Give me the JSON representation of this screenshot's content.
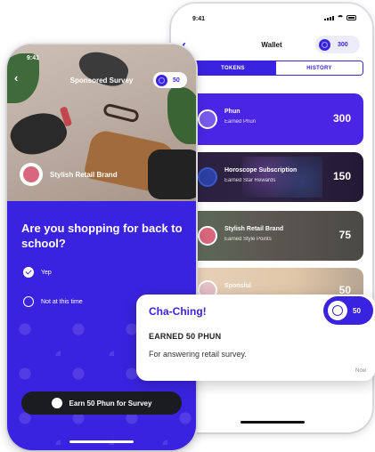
{
  "wallet_screen": {
    "status_time": "9:41",
    "back_icon": "chevron-left-icon",
    "title": "Wallet",
    "balance": "300",
    "tabs": [
      {
        "label": "TOKENS",
        "active": true
      },
      {
        "label": "HISTORY",
        "active": false
      }
    ],
    "cards": [
      {
        "title": "Phun",
        "subtitle": "Earned Phun",
        "value": "300"
      },
      {
        "title": "Horoscope Subscription",
        "subtitle": "Earned Star Rewards",
        "value": "150"
      },
      {
        "title": "Stylish Retail Brand",
        "subtitle": "Earned Style Points",
        "value": "75"
      },
      {
        "title": "Sponsful",
        "subtitle": "",
        "value": "50"
      }
    ]
  },
  "survey_screen": {
    "status_time": "9:41",
    "back_icon": "chevron-left-icon",
    "title": "Sponsored Survey",
    "reward": "50",
    "brand_name": "Stylish Retail Brand",
    "question": "Are you shopping for back to school?",
    "options": [
      {
        "label": "Yep",
        "selected": true
      },
      {
        "label": "Not at this time",
        "selected": false
      }
    ],
    "cta_label": "Earn 50 Phun for Survey"
  },
  "notification": {
    "title": "Cha-Ching!",
    "headline": "EARNED 50 PHUN",
    "body": "For answering retail survey.",
    "time": "Now",
    "badge": "50"
  },
  "colors": {
    "brand": "#3a23e0",
    "dark_button": "#1b1b22",
    "brand_pink": "#d9667d"
  }
}
